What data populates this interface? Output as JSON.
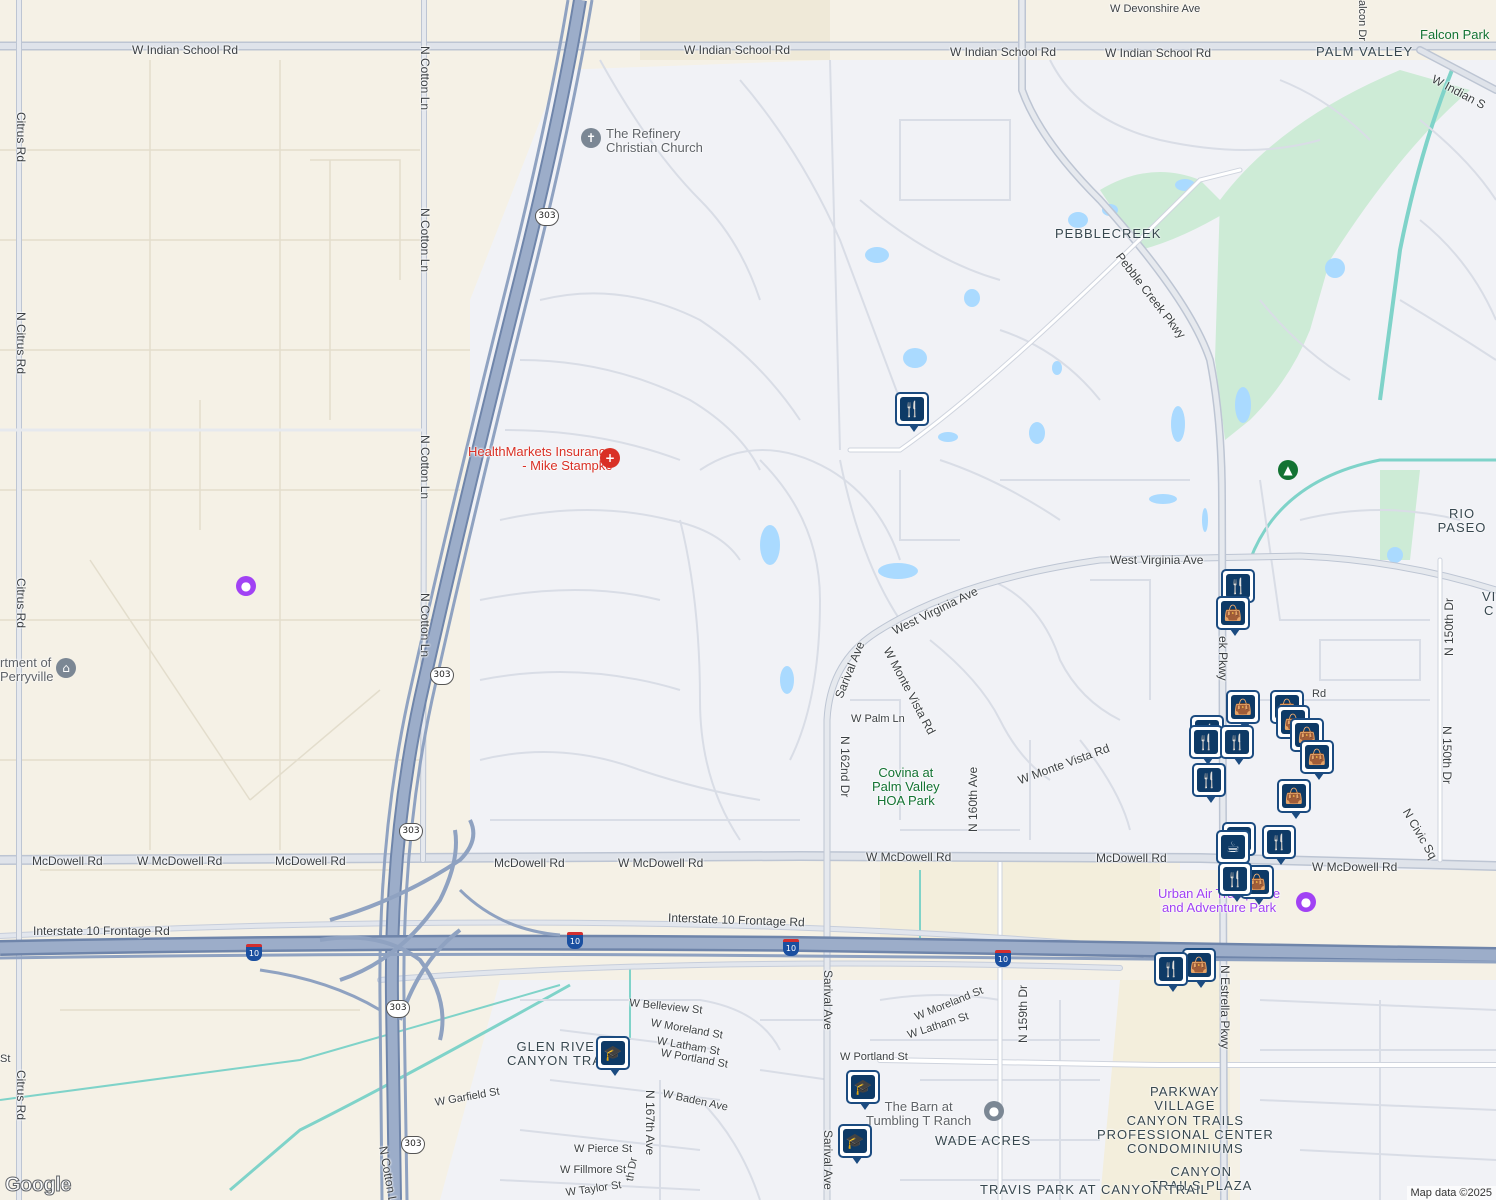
{
  "roads": {
    "w_indian_school": [
      "W Indian School Rd",
      "W Indian School Rd",
      "W Indian School Rd",
      "W Indian School Rd",
      "W Indian S"
    ],
    "mcdowell": [
      "McDowell Rd",
      "W McDowell Rd",
      "McDowell Rd",
      "McDowell Rd",
      "W McDowell Rd",
      "W McDowell Rd",
      "McDowell Rd",
      "W McDowell Rd"
    ],
    "i10_frontage": [
      "Interstate 10 Frontage Rd",
      "Interstate 10 Frontage Rd"
    ],
    "citrus": [
      "Citrus Rd",
      "N Citrus Rd",
      "Citrus Rd",
      "Citrus Rd"
    ],
    "cotton": [
      "N Cotton Ln",
      "N Cotton Ln",
      "N Cotton Ln",
      "N Cotton Ln",
      "N Cotton Ln"
    ],
    "sarival": [
      "Sarival Ave",
      "Sarival Ave",
      "Sarival Ave"
    ],
    "west_virginia": [
      "West Virginia Ave",
      "West Virginia Ave"
    ],
    "pebble_creek": "Pebble Creek Pkwy",
    "pebble_creek_lower": "ek Pkwy",
    "estrella": "N Estrella Pkwy",
    "n_150th_a": "N 150th Dr",
    "n_150th_b": "N 150th Dr",
    "n_civic": "N Civic Sq",
    "n_162nd": "N 162nd Dr",
    "n_160th": "N 160th Ave",
    "n_159th": "N 159th Dr",
    "n_167th": "N 167th Ave",
    "w_devonshire": "W Devonshire Ave",
    "falcon_dr": "alcon Dr",
    "w_monte_vista_rd": "W Monte Vista Rd",
    "w_monte_vista_rd2": "W Monte Vista Rd",
    "w_palm": "W Palm Ln",
    "w_moreland": "W Moreland St",
    "w_moreland2": "W Moreland St",
    "w_latham": "W Latham St",
    "w_latham2": "W Latham St",
    "w_portland": "W Portland St",
    "w_portland2": "W Portland St",
    "w_belleview": "W Belleview St",
    "w_baden": "W Baden Ave",
    "w_garfield": "W Garfield St",
    "w_pierce": "W Pierce St",
    "w_fillmore": "W Fillmore St",
    "w_taylor": "W Taylor St",
    "th_dr": "th Dr",
    "st_frag": "St",
    "rd_frag": "Rd",
    "shields": {
      "sr303": "303",
      "i10": "10"
    }
  },
  "areas": {
    "pebblecreek": "PEBBLECREEK",
    "palm_valley": "PALM VALLEY",
    "falcon_park": "Falcon Park",
    "rio_paseo": "RIO PASEO",
    "v_frag": "VI",
    "c_frag": "C",
    "glen_river": [
      "GLEN RIVER",
      "CANYON TRAIL"
    ],
    "wade_acres": "WADE ACRES",
    "parkway_village": [
      "PARKWAY",
      "VILLAGE"
    ],
    "canyon_trails_pc": [
      "CANYON TRAILS",
      "PROFESSIONAL CENTER",
      "CONDOMINIUMS"
    ],
    "canyon_trails_plaza": [
      "CANYON",
      "TRAILS PLAZA"
    ],
    "travis_park": "TRAVIS PARK AT CANYON TRAIL"
  },
  "pois": {
    "refinery": [
      "The Refinery",
      "Christian Church"
    ],
    "healthmarkets": [
      "HealthMarkets Insurance",
      "- Mike Stampke"
    ],
    "perryville": [
      "rtment of",
      "Perryville"
    ],
    "covina": [
      "Covina at",
      "Palm Valley",
      "HOA Park"
    ],
    "urban_air": [
      "Urban Air Trampoline",
      "and Adventure Park"
    ],
    "the_barn": [
      "The Barn at",
      "Tumbling T Ranch"
    ]
  },
  "icons": {
    "restaurant": "restaurant-icon",
    "shopping": "shopping-bag-icon",
    "school": "school-icon",
    "cafe": "cafe-icon",
    "church": "church-icon",
    "hospital": "hospital-icon",
    "tree": "park-tree-icon",
    "gov": "government-icon",
    "museum": "museum-icon"
  },
  "colors": {
    "land": "#f5f1e6",
    "residential": "#f1f2f6",
    "road": "#ffffff",
    "highway": "#8d9fbf",
    "water": "#aadaff",
    "park": "#b8e6c7",
    "pin": "#0e3a66",
    "poi_red": "#d93025",
    "poi_purple": "#a142f4",
    "poi_green": "#137333"
  },
  "footer": {
    "google": "Google",
    "attribution": "Map data ©2025"
  }
}
